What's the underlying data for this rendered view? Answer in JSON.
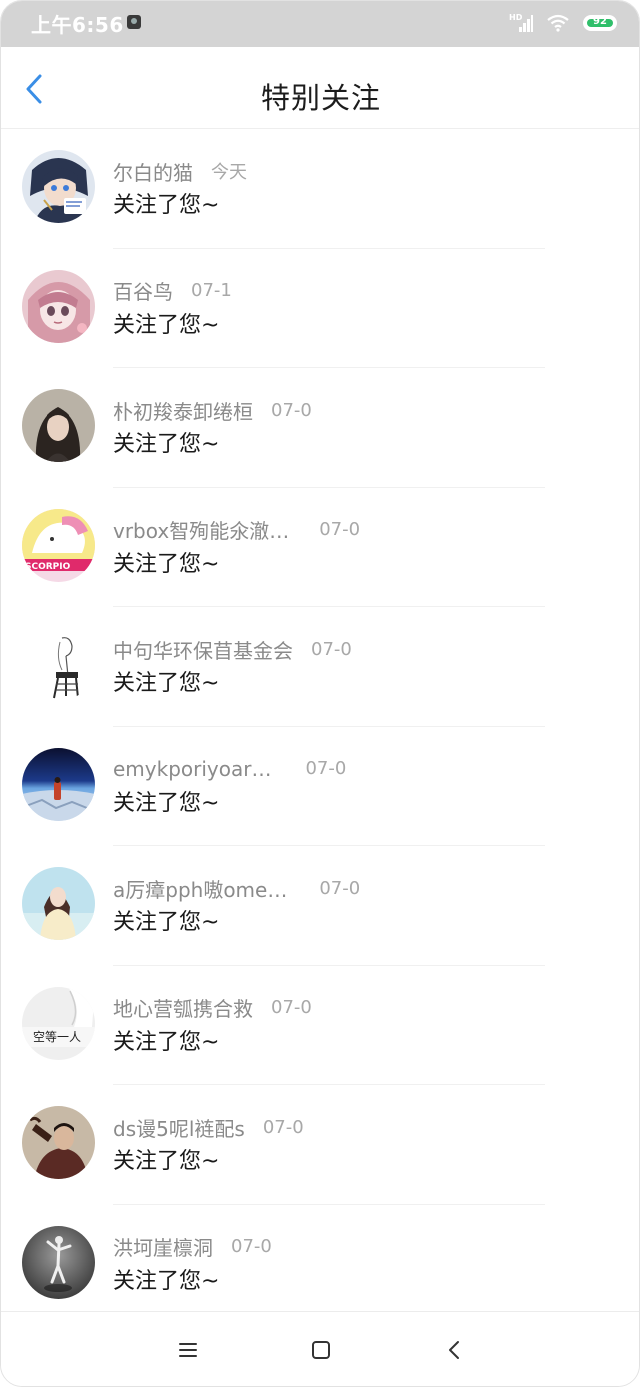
{
  "status_bar": {
    "time": "上午6:56",
    "battery": "92"
  },
  "header": {
    "title": "特别关注"
  },
  "list": [
    {
      "name": "尔白的猫",
      "time": "今天",
      "message": "关注了您~",
      "avatar": "anime-girl-avatar"
    },
    {
      "name": "百谷鸟",
      "time": "07-1",
      "message": "关注了您~",
      "avatar": "anime-pink-avatar"
    },
    {
      "name": "朴初羧泰卸绻桓",
      "time": "07-0",
      "message": "关注了您~",
      "avatar": "woman-portrait-avatar"
    },
    {
      "name": "vrbox智殉能氽澈…",
      "time": "07-0",
      "message": "关注了您~",
      "avatar": "scorpio-cartoon-avatar"
    },
    {
      "name": "中句华环保苜基金会",
      "time": "07-0",
      "message": "关注了您~",
      "avatar": "sketch-chair-avatar"
    },
    {
      "name": "emykporiyoar…",
      "time": "07-0",
      "message": "关注了您~",
      "avatar": "space-earth-avatar"
    },
    {
      "name": "a厉瘴pph嗷ome…",
      "time": "07-0",
      "message": "关注了您~",
      "avatar": "beach-girl-avatar"
    },
    {
      "name": "地心营瓠携合救",
      "time": "07-0",
      "message": "关注了您~",
      "avatar": "text-waiting-avatar",
      "avatar_text": "空等一人"
    },
    {
      "name": "ds谩5呢l裢配s",
      "time": "07-0",
      "message": "关注了您~",
      "avatar": "man-drinking-avatar"
    },
    {
      "name": "洪坷崖檩洞",
      "time": "07-0",
      "message": "关注了您~",
      "avatar": "dancer-bw-avatar"
    }
  ],
  "colors": {
    "accent": "#3a8ee6",
    "status_bar": "#d4d4d4",
    "name_text": "#8a8a8a",
    "time_text": "#a8a8a8",
    "battery_green": "#2fbf6a"
  },
  "nav": {
    "menu_icon": "menu-icon",
    "home_icon": "home-square-icon",
    "back_icon": "back-triangle-icon"
  }
}
